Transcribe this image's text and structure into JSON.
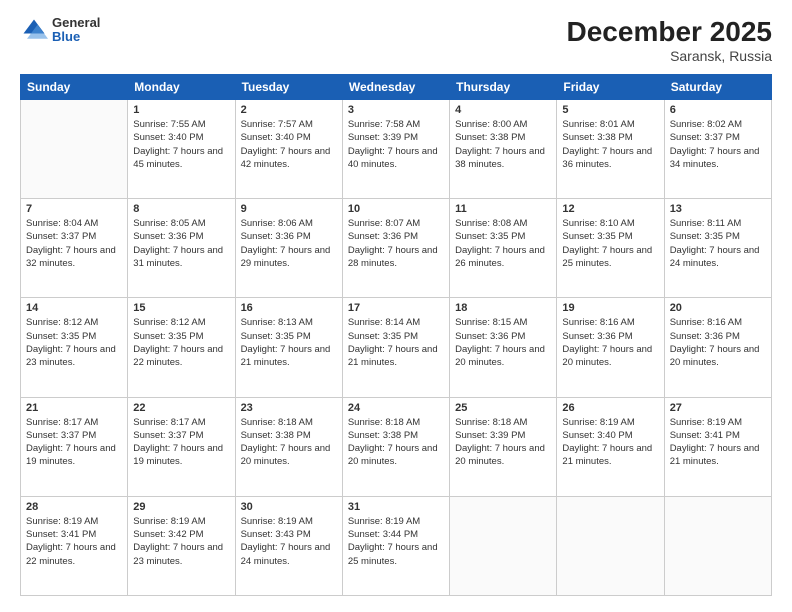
{
  "header": {
    "logo": {
      "general": "General",
      "blue": "Blue"
    },
    "title": "December 2025",
    "subtitle": "Saransk, Russia"
  },
  "days_of_week": [
    "Sunday",
    "Monday",
    "Tuesday",
    "Wednesday",
    "Thursday",
    "Friday",
    "Saturday"
  ],
  "weeks": [
    [
      {
        "day": "",
        "sunrise": "",
        "sunset": "",
        "daylight": ""
      },
      {
        "day": "1",
        "sunrise": "Sunrise: 7:55 AM",
        "sunset": "Sunset: 3:40 PM",
        "daylight": "Daylight: 7 hours and 45 minutes."
      },
      {
        "day": "2",
        "sunrise": "Sunrise: 7:57 AM",
        "sunset": "Sunset: 3:40 PM",
        "daylight": "Daylight: 7 hours and 42 minutes."
      },
      {
        "day": "3",
        "sunrise": "Sunrise: 7:58 AM",
        "sunset": "Sunset: 3:39 PM",
        "daylight": "Daylight: 7 hours and 40 minutes."
      },
      {
        "day": "4",
        "sunrise": "Sunrise: 8:00 AM",
        "sunset": "Sunset: 3:38 PM",
        "daylight": "Daylight: 7 hours and 38 minutes."
      },
      {
        "day": "5",
        "sunrise": "Sunrise: 8:01 AM",
        "sunset": "Sunset: 3:38 PM",
        "daylight": "Daylight: 7 hours and 36 minutes."
      },
      {
        "day": "6",
        "sunrise": "Sunrise: 8:02 AM",
        "sunset": "Sunset: 3:37 PM",
        "daylight": "Daylight: 7 hours and 34 minutes."
      }
    ],
    [
      {
        "day": "7",
        "sunrise": "Sunrise: 8:04 AM",
        "sunset": "Sunset: 3:37 PM",
        "daylight": "Daylight: 7 hours and 32 minutes."
      },
      {
        "day": "8",
        "sunrise": "Sunrise: 8:05 AM",
        "sunset": "Sunset: 3:36 PM",
        "daylight": "Daylight: 7 hours and 31 minutes."
      },
      {
        "day": "9",
        "sunrise": "Sunrise: 8:06 AM",
        "sunset": "Sunset: 3:36 PM",
        "daylight": "Daylight: 7 hours and 29 minutes."
      },
      {
        "day": "10",
        "sunrise": "Sunrise: 8:07 AM",
        "sunset": "Sunset: 3:36 PM",
        "daylight": "Daylight: 7 hours and 28 minutes."
      },
      {
        "day": "11",
        "sunrise": "Sunrise: 8:08 AM",
        "sunset": "Sunset: 3:35 PM",
        "daylight": "Daylight: 7 hours and 26 minutes."
      },
      {
        "day": "12",
        "sunrise": "Sunrise: 8:10 AM",
        "sunset": "Sunset: 3:35 PM",
        "daylight": "Daylight: 7 hours and 25 minutes."
      },
      {
        "day": "13",
        "sunrise": "Sunrise: 8:11 AM",
        "sunset": "Sunset: 3:35 PM",
        "daylight": "Daylight: 7 hours and 24 minutes."
      }
    ],
    [
      {
        "day": "14",
        "sunrise": "Sunrise: 8:12 AM",
        "sunset": "Sunset: 3:35 PM",
        "daylight": "Daylight: 7 hours and 23 minutes."
      },
      {
        "day": "15",
        "sunrise": "Sunrise: 8:12 AM",
        "sunset": "Sunset: 3:35 PM",
        "daylight": "Daylight: 7 hours and 22 minutes."
      },
      {
        "day": "16",
        "sunrise": "Sunrise: 8:13 AM",
        "sunset": "Sunset: 3:35 PM",
        "daylight": "Daylight: 7 hours and 21 minutes."
      },
      {
        "day": "17",
        "sunrise": "Sunrise: 8:14 AM",
        "sunset": "Sunset: 3:35 PM",
        "daylight": "Daylight: 7 hours and 21 minutes."
      },
      {
        "day": "18",
        "sunrise": "Sunrise: 8:15 AM",
        "sunset": "Sunset: 3:36 PM",
        "daylight": "Daylight: 7 hours and 20 minutes."
      },
      {
        "day": "19",
        "sunrise": "Sunrise: 8:16 AM",
        "sunset": "Sunset: 3:36 PM",
        "daylight": "Daylight: 7 hours and 20 minutes."
      },
      {
        "day": "20",
        "sunrise": "Sunrise: 8:16 AM",
        "sunset": "Sunset: 3:36 PM",
        "daylight": "Daylight: 7 hours and 20 minutes."
      }
    ],
    [
      {
        "day": "21",
        "sunrise": "Sunrise: 8:17 AM",
        "sunset": "Sunset: 3:37 PM",
        "daylight": "Daylight: 7 hours and 19 minutes."
      },
      {
        "day": "22",
        "sunrise": "Sunrise: 8:17 AM",
        "sunset": "Sunset: 3:37 PM",
        "daylight": "Daylight: 7 hours and 19 minutes."
      },
      {
        "day": "23",
        "sunrise": "Sunrise: 8:18 AM",
        "sunset": "Sunset: 3:38 PM",
        "daylight": "Daylight: 7 hours and 20 minutes."
      },
      {
        "day": "24",
        "sunrise": "Sunrise: 8:18 AM",
        "sunset": "Sunset: 3:38 PM",
        "daylight": "Daylight: 7 hours and 20 minutes."
      },
      {
        "day": "25",
        "sunrise": "Sunrise: 8:18 AM",
        "sunset": "Sunset: 3:39 PM",
        "daylight": "Daylight: 7 hours and 20 minutes."
      },
      {
        "day": "26",
        "sunrise": "Sunrise: 8:19 AM",
        "sunset": "Sunset: 3:40 PM",
        "daylight": "Daylight: 7 hours and 21 minutes."
      },
      {
        "day": "27",
        "sunrise": "Sunrise: 8:19 AM",
        "sunset": "Sunset: 3:41 PM",
        "daylight": "Daylight: 7 hours and 21 minutes."
      }
    ],
    [
      {
        "day": "28",
        "sunrise": "Sunrise: 8:19 AM",
        "sunset": "Sunset: 3:41 PM",
        "daylight": "Daylight: 7 hours and 22 minutes."
      },
      {
        "day": "29",
        "sunrise": "Sunrise: 8:19 AM",
        "sunset": "Sunset: 3:42 PM",
        "daylight": "Daylight: 7 hours and 23 minutes."
      },
      {
        "day": "30",
        "sunrise": "Sunrise: 8:19 AM",
        "sunset": "Sunset: 3:43 PM",
        "daylight": "Daylight: 7 hours and 24 minutes."
      },
      {
        "day": "31",
        "sunrise": "Sunrise: 8:19 AM",
        "sunset": "Sunset: 3:44 PM",
        "daylight": "Daylight: 7 hours and 25 minutes."
      },
      {
        "day": "",
        "sunrise": "",
        "sunset": "",
        "daylight": ""
      },
      {
        "day": "",
        "sunrise": "",
        "sunset": "",
        "daylight": ""
      },
      {
        "day": "",
        "sunrise": "",
        "sunset": "",
        "daylight": ""
      }
    ]
  ]
}
